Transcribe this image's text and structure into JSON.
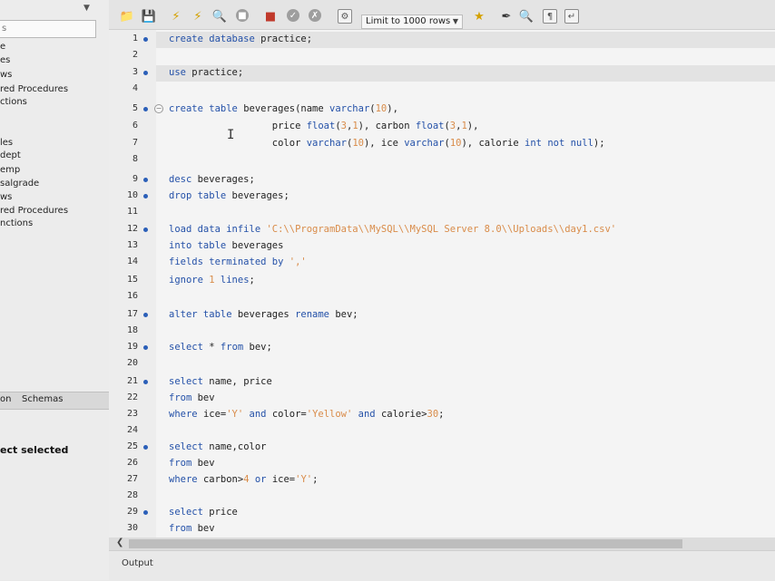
{
  "navigator": {
    "search_placeholder": "s",
    "items_top": [
      "e",
      "es",
      "ws",
      "red Procedures",
      "ctions"
    ],
    "items_bottom": [
      "les",
      "dept",
      "emp",
      "salgrade",
      "ws",
      "red Procedures",
      "nctions"
    ],
    "tabs": [
      "on",
      "Schemas"
    ],
    "info_text": "ect selected"
  },
  "toolbar": {
    "limit_label": "Limit to 1000 rows",
    "icons": [
      "open-folder-icon",
      "save-icon",
      "execute-icon",
      "execute-current-icon",
      "explain-icon",
      "stop-icon",
      "toggle-error-icon",
      "commit-icon",
      "rollback-icon",
      "autocommit-icon",
      "beautify-icon",
      "eraser-icon",
      "find-icon",
      "invisible-chars-icon",
      "wrap-icon"
    ]
  },
  "editor": {
    "lines": [
      {
        "n": "1",
        "dot": true,
        "code": [
          [
            "kw",
            "create database "
          ],
          [
            "t",
            "practice;"
          ]
        ]
      },
      {
        "n": "2",
        "dot": false,
        "code": []
      },
      {
        "n": "3",
        "dot": true,
        "code": [
          [
            "kw",
            "use "
          ],
          [
            "t",
            "practice;"
          ]
        ]
      },
      {
        "n": "4",
        "dot": false,
        "code": []
      },
      {
        "n": "5",
        "dot": true,
        "code": [
          [
            "kw",
            "create table "
          ],
          [
            "t",
            "beverages(name "
          ],
          [
            "kw",
            "varchar"
          ],
          [
            "t",
            "("
          ],
          [
            "num",
            "10"
          ],
          [
            "t",
            "),"
          ]
        ]
      },
      {
        "n": "6",
        "dot": false,
        "code": [
          [
            "t",
            "                  price "
          ],
          [
            "kw",
            "float"
          ],
          [
            "t",
            "("
          ],
          [
            "num",
            "3"
          ],
          [
            "t",
            ","
          ],
          [
            "num",
            "1"
          ],
          [
            "t",
            "), carbon "
          ],
          [
            "kw",
            "float"
          ],
          [
            "t",
            "("
          ],
          [
            "num",
            "3"
          ],
          [
            "t",
            ","
          ],
          [
            "num",
            "1"
          ],
          [
            "t",
            "),"
          ]
        ]
      },
      {
        "n": "7",
        "dot": false,
        "code": [
          [
            "t",
            "                  color "
          ],
          [
            "kw",
            "varchar"
          ],
          [
            "t",
            "("
          ],
          [
            "num",
            "10"
          ],
          [
            "t",
            "), ice "
          ],
          [
            "kw",
            "varchar"
          ],
          [
            "t",
            "("
          ],
          [
            "num",
            "10"
          ],
          [
            "t",
            "), calorie "
          ],
          [
            "kw",
            "int not null"
          ],
          [
            "t",
            ");"
          ]
        ]
      },
      {
        "n": "8",
        "dot": false,
        "code": []
      },
      {
        "n": "9",
        "dot": true,
        "code": [
          [
            "kw",
            "desc "
          ],
          [
            "t",
            "beverages;"
          ]
        ]
      },
      {
        "n": "10",
        "dot": true,
        "code": [
          [
            "kw",
            "drop table "
          ],
          [
            "t",
            "beverages;"
          ]
        ]
      },
      {
        "n": "11",
        "dot": false,
        "code": []
      },
      {
        "n": "12",
        "dot": true,
        "code": [
          [
            "kw",
            "load data infile "
          ],
          [
            "str",
            "'C:\\\\ProgramData\\\\MySQL\\\\MySQL Server 8.0\\\\Uploads\\\\day1.csv'"
          ]
        ]
      },
      {
        "n": "13",
        "dot": false,
        "code": [
          [
            "kw",
            "into table "
          ],
          [
            "t",
            "beverages"
          ]
        ]
      },
      {
        "n": "14",
        "dot": false,
        "code": [
          [
            "kw",
            "fields terminated by "
          ],
          [
            "str",
            "','"
          ]
        ]
      },
      {
        "n": "15",
        "dot": false,
        "code": [
          [
            "kw",
            "ignore "
          ],
          [
            "num",
            "1"
          ],
          [
            "kw",
            " lines"
          ],
          [
            "t",
            ";"
          ]
        ]
      },
      {
        "n": "16",
        "dot": false,
        "code": []
      },
      {
        "n": "17",
        "dot": true,
        "code": [
          [
            "kw",
            "alter table "
          ],
          [
            "t",
            "beverages "
          ],
          [
            "kw",
            "rename "
          ],
          [
            "t",
            "bev;"
          ]
        ]
      },
      {
        "n": "18",
        "dot": false,
        "code": []
      },
      {
        "n": "19",
        "dot": true,
        "code": [
          [
            "kw",
            "select "
          ],
          [
            "t",
            "* "
          ],
          [
            "kw",
            "from "
          ],
          [
            "t",
            "bev;"
          ]
        ]
      },
      {
        "n": "20",
        "dot": false,
        "code": []
      },
      {
        "n": "21",
        "dot": true,
        "code": [
          [
            "kw",
            "select "
          ],
          [
            "t",
            "name, price"
          ]
        ]
      },
      {
        "n": "22",
        "dot": false,
        "code": [
          [
            "kw",
            "from "
          ],
          [
            "t",
            "bev"
          ]
        ]
      },
      {
        "n": "23",
        "dot": false,
        "code": [
          [
            "kw",
            "where "
          ],
          [
            "t",
            "ice="
          ],
          [
            "str",
            "'Y'"
          ],
          [
            "kw",
            " and "
          ],
          [
            "t",
            "color="
          ],
          [
            "str",
            "'Yellow'"
          ],
          [
            "kw",
            " and "
          ],
          [
            "t",
            "calorie>"
          ],
          [
            "num",
            "30"
          ],
          [
            "t",
            ";"
          ]
        ]
      },
      {
        "n": "24",
        "dot": false,
        "code": []
      },
      {
        "n": "25",
        "dot": true,
        "code": [
          [
            "kw",
            "select "
          ],
          [
            "t",
            "name,color"
          ]
        ]
      },
      {
        "n": "26",
        "dot": false,
        "code": [
          [
            "kw",
            "from "
          ],
          [
            "t",
            "bev"
          ]
        ]
      },
      {
        "n": "27",
        "dot": false,
        "code": [
          [
            "kw",
            "where "
          ],
          [
            "t",
            "carbon>"
          ],
          [
            "num",
            "4"
          ],
          [
            "kw",
            " or "
          ],
          [
            "t",
            "ice="
          ],
          [
            "str",
            "'Y'"
          ],
          [
            "t",
            ";"
          ]
        ]
      },
      {
        "n": "28",
        "dot": false,
        "code": []
      },
      {
        "n": "29",
        "dot": true,
        "code": [
          [
            "kw",
            "select "
          ],
          [
            "t",
            "price"
          ]
        ]
      },
      {
        "n": "30",
        "dot": false,
        "code": [
          [
            "kw",
            "from "
          ],
          [
            "t",
            "bev"
          ]
        ]
      }
    ]
  },
  "output": {
    "label": "Output"
  }
}
